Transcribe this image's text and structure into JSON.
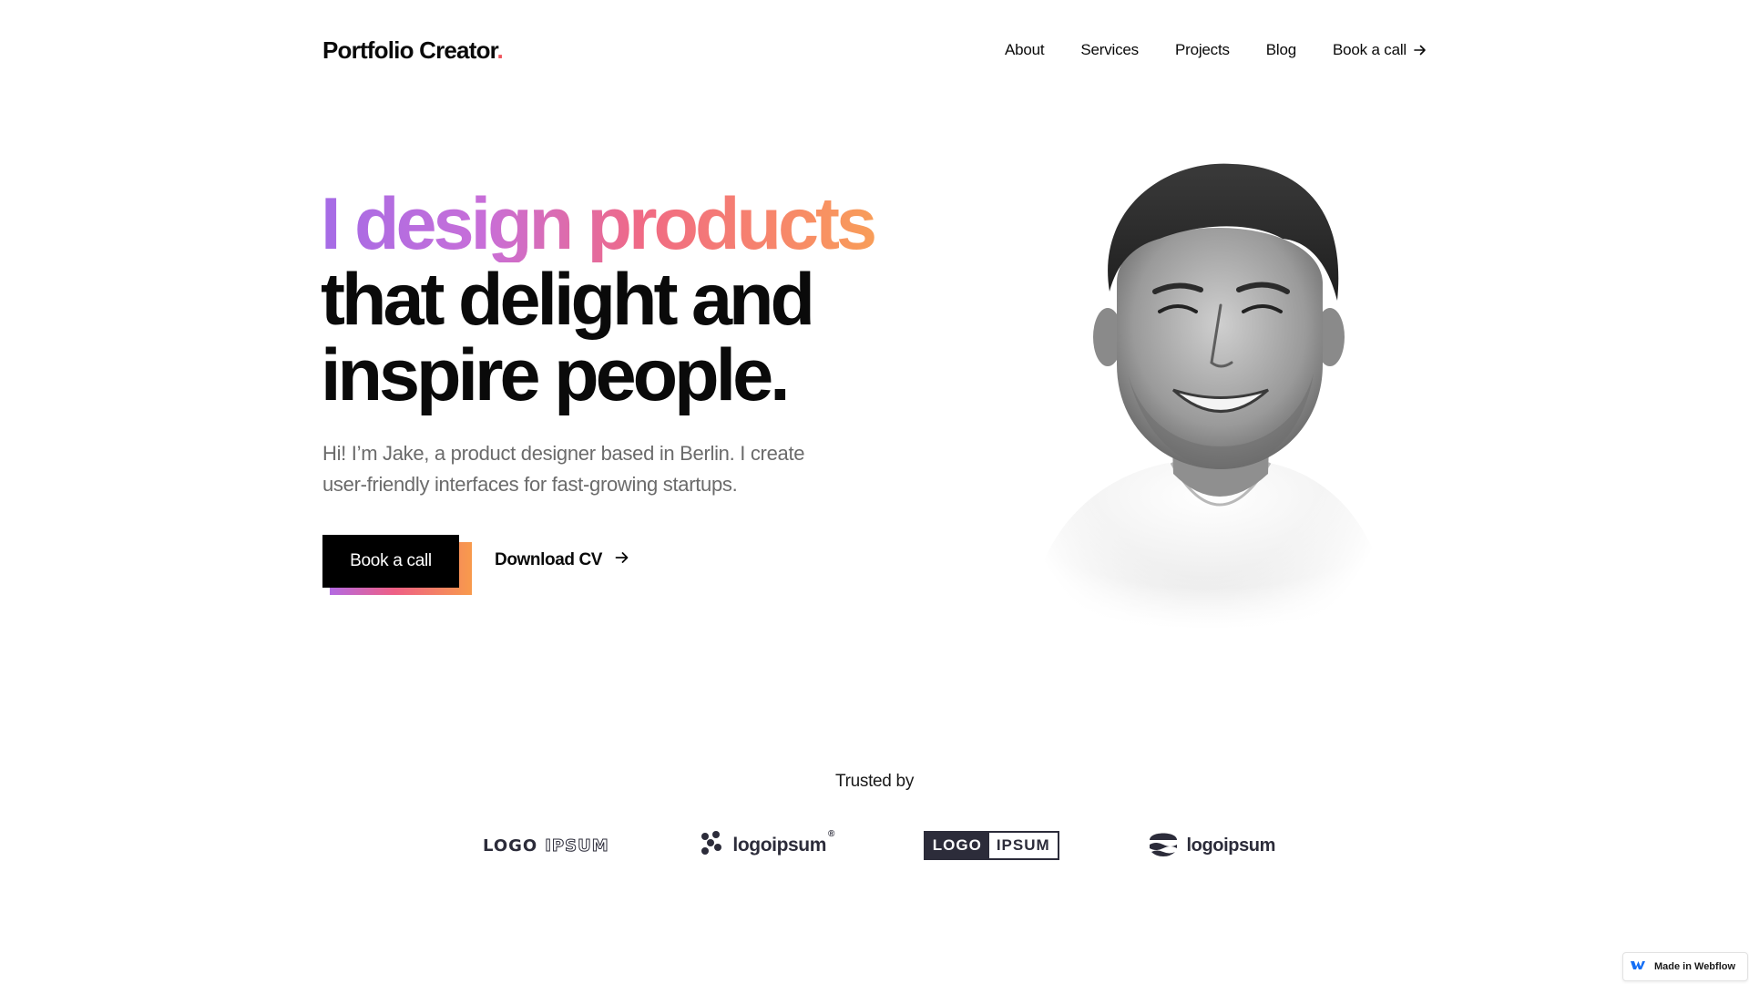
{
  "header": {
    "brand": "Portfolio Creator",
    "brand_dot": ".",
    "nav": [
      {
        "label": "About"
      },
      {
        "label": "Services"
      },
      {
        "label": "Projects"
      },
      {
        "label": "Blog"
      },
      {
        "label": "Book a call",
        "icon": "arrow-right-icon"
      }
    ]
  },
  "hero": {
    "title_line1": "I design products",
    "title_line2": "that delight and",
    "title_line3": "inspire people.",
    "subtitle": "Hi! I’m Jake, a product designer based in Berlin. I create user-friendly interfaces for fast-growing startups.",
    "cta_primary": "Book a call",
    "cta_secondary": "Download CV",
    "cta_secondary_icon": "arrow-right-icon",
    "portrait": "grayscale portrait of smiling man in white t-shirt"
  },
  "trusted": {
    "label": "Trusted by",
    "logos": [
      {
        "part1": "LOGO",
        "part2": "IPSUM"
      },
      {
        "text": "logoipsum",
        "mark": "®"
      },
      {
        "part1": "LOGO",
        "part2": "IPSUM"
      },
      {
        "text": "logoipsum"
      }
    ]
  },
  "badge": {
    "label": "Made in Webflow",
    "icon": "webflow-icon"
  },
  "colors": {
    "accent_dot": "#f0555d",
    "gradient": [
      "#a56ce6",
      "#f06a85",
      "#f9a453"
    ],
    "text": "#0a0a0a",
    "muted": "#6b6b6b"
  }
}
